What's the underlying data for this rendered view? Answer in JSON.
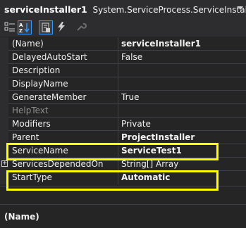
{
  "header": {
    "object_name": "serviceInstaller1",
    "object_type": "System.ServiceProcess.ServiceInstaller"
  },
  "toolbar": {
    "buttons": [
      "categorized-icon",
      "alphabetical-icon",
      "properties-icon",
      "events-icon",
      "property-pages-icon"
    ]
  },
  "properties": [
    {
      "name": "(Name)",
      "value": "serviceInstaller1",
      "bold": true
    },
    {
      "name": "DelayedAutoStart",
      "value": "False"
    },
    {
      "name": "Description",
      "value": ""
    },
    {
      "name": "DisplayName",
      "value": ""
    },
    {
      "name": "GenerateMember",
      "value": "True"
    },
    {
      "name": "HelpText",
      "value": "",
      "disabled": true
    },
    {
      "name": "Modifiers",
      "value": "Private"
    },
    {
      "name": "Parent",
      "value": "ProjectInstaller",
      "bold": true
    },
    {
      "name": "ServiceName",
      "value": "ServiceTest1",
      "bold": true
    },
    {
      "name": "ServicesDependedOn",
      "value": "String[] Array",
      "expandable": true
    },
    {
      "name": "StartType",
      "value": "Automatic",
      "bold": true
    }
  ],
  "highlight_color": "#ffff00",
  "description": {
    "title": "(Name)"
  }
}
